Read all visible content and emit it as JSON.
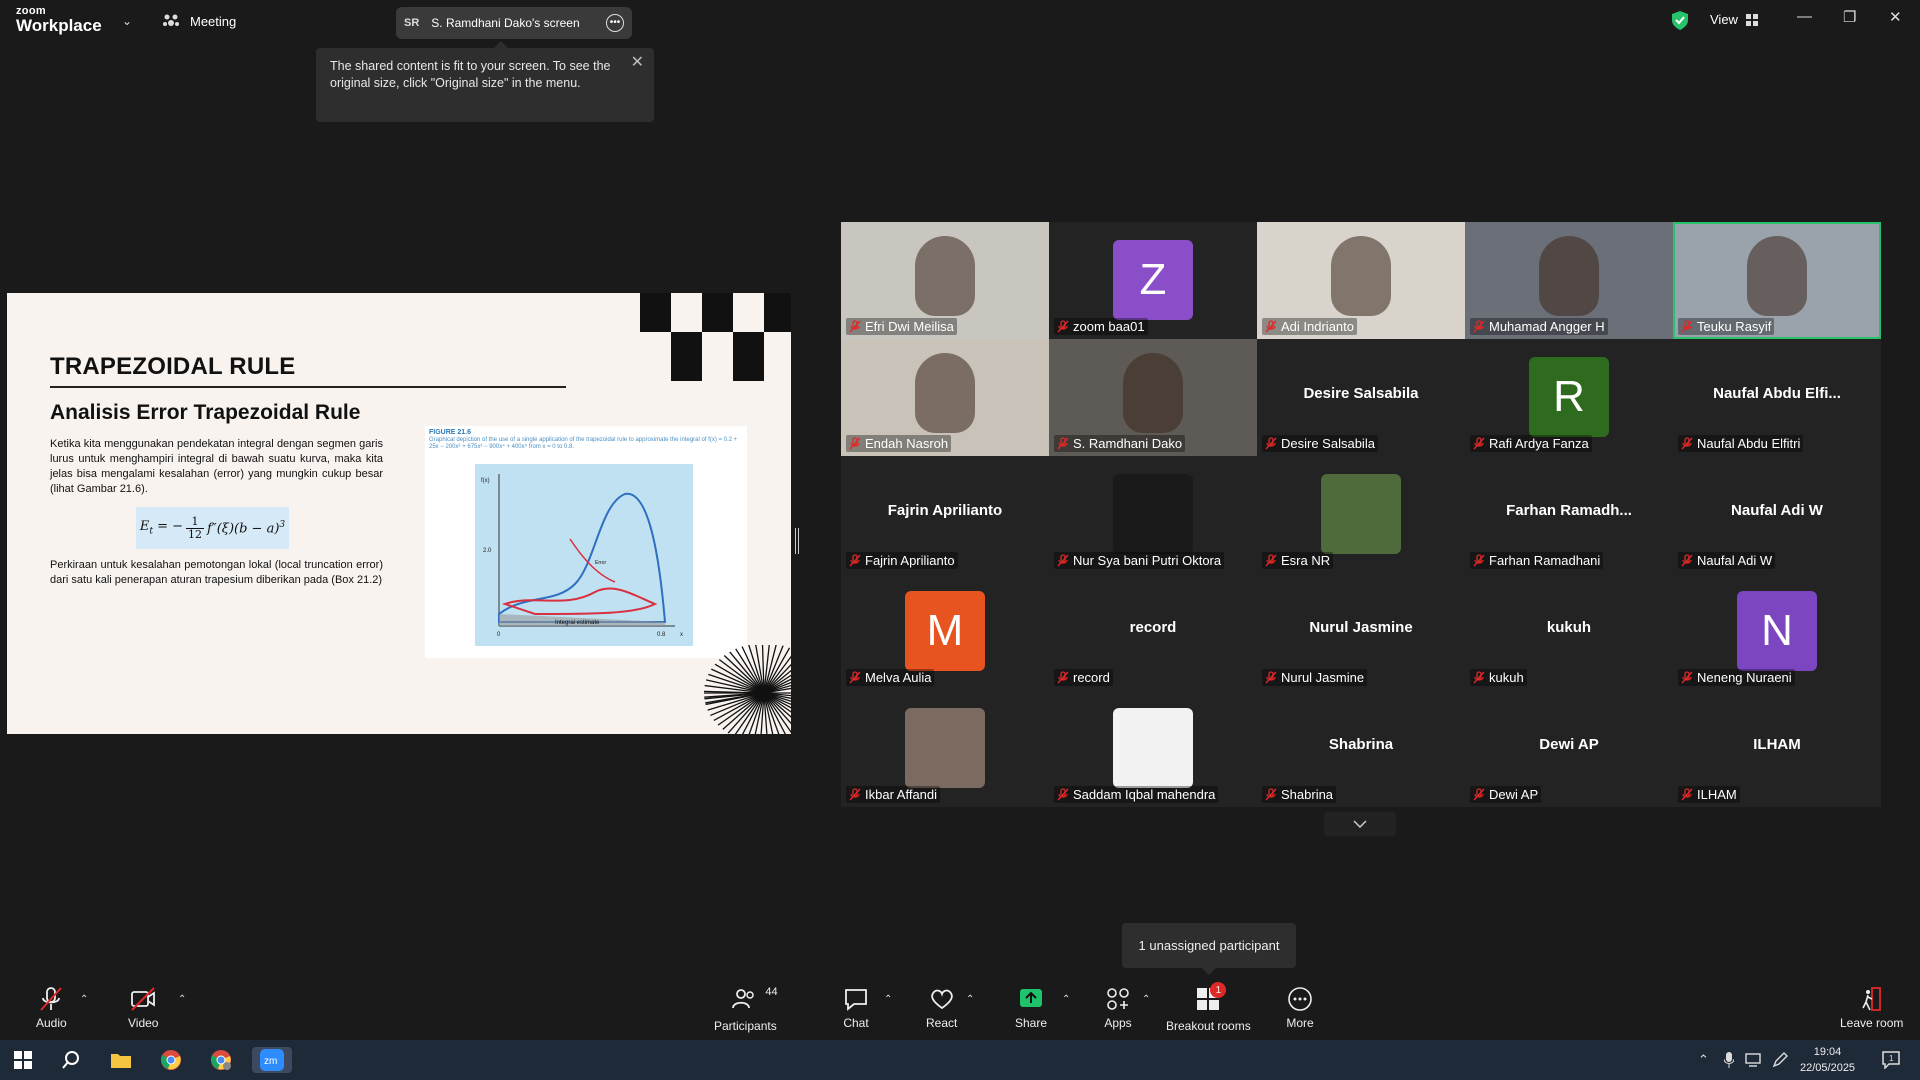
{
  "app": {
    "logo_line1": "zoom",
    "logo_line2": "Workplace",
    "meeting_label": "Meeting",
    "share_initials": "SR",
    "share_label": "S. Ramdhani Dako's screen",
    "view_label": "View"
  },
  "tooltip": {
    "text": "The shared content is fit to your screen. To see the original size, click \"Original size\" in the menu."
  },
  "slide": {
    "title": "TRAPEZOIDAL RULE",
    "subtitle": "Analisis Error Trapezoidal Rule",
    "para1": "Ketika kita menggunakan pendekatan integral dengan segmen garis lurus untuk menghampiri integral di bawah suatu kurva, maka kita jelas bisa mengalami kesalahan (error) yang mungkin cukup besar (lihat Gambar 21.6).",
    "para2": "Perkiraan untuk kesalahan pemotongan lokal (local truncation error) dari satu kali penerapan aturan trapesium diberikan pada (Box 21.2)",
    "figure_title": "FIGURE 21.6",
    "figure_caption": "Graphical depiction of the use of a single application of the trapezoidal rule to approximate the integral of f(x) = 0.2 + 25x − 200x² + 675x³ − 900x⁴ + 400x⁵ from x = 0 to 0.8.",
    "fig_ylabel": "f(x)",
    "fig_ytick": "2.0",
    "fig_x0": "0",
    "fig_x1": "0.8",
    "fig_xlabel": "x",
    "fig_estimate": "Integral estimate",
    "fig_error": "Error"
  },
  "participants_grid": [
    {
      "name": "Efri Dwi Meilisa",
      "type": "video",
      "bg": "#c9c6c0"
    },
    {
      "name": "zoom baa01",
      "type": "avatar",
      "letter": "Z",
      "color": "#8a4fc8"
    },
    {
      "name": "Adi Indrianto",
      "type": "video",
      "bg": "#d8d4cc"
    },
    {
      "name": "Muhamad Angger H",
      "type": "video",
      "bg": "#6b6f78"
    },
    {
      "name": "Teuku Rasyif",
      "type": "video",
      "bg": "#9aa3ab",
      "active": true
    },
    {
      "name": "Endah Nasroh",
      "type": "video",
      "bg": "#c8c2b9"
    },
    {
      "name": "S. Ramdhani Dako",
      "type": "video",
      "bg": "#5e5a56"
    },
    {
      "name": "Desire Salsabila",
      "type": "name",
      "display": "Desire Salsabila"
    },
    {
      "name": "Rafi Ardya Fanza",
      "type": "avatar",
      "letter": "R",
      "color": "#2e6b1f"
    },
    {
      "name": "Naufal Abdu Elfitri",
      "type": "name",
      "display": "Naufal  Abdu  Elfi..."
    },
    {
      "name": "Fajrin Aprilianto",
      "type": "name",
      "display": "Fajrin Aprilianto"
    },
    {
      "name": "Nur Sya bani Putri Oktora",
      "type": "photo",
      "bg": "#1a1a1a"
    },
    {
      "name": "Esra NR",
      "type": "photo",
      "bg": "#4f6b3c"
    },
    {
      "name": "Farhan Ramadhani",
      "type": "name",
      "display": "Farhan  Ramadh..."
    },
    {
      "name": "Naufal Adi W",
      "type": "name",
      "display": "Naufal Adi W"
    },
    {
      "name": "Melva Aulia",
      "type": "avatar",
      "letter": "M",
      "color": "#e8541f"
    },
    {
      "name": "record",
      "type": "name",
      "display": "record"
    },
    {
      "name": "Nurul Jasmine",
      "type": "name",
      "display": "Nurul Jasmine"
    },
    {
      "name": "kukuh",
      "type": "name",
      "display": "kukuh"
    },
    {
      "name": "Neneng Nuraeni",
      "type": "avatar",
      "letter": "N",
      "color": "#7c46c0"
    },
    {
      "name": "Ikbar Affandi",
      "type": "photo",
      "bg": "#7a6a60"
    },
    {
      "name": "Saddam Iqbal mahendra",
      "type": "photo",
      "bg": "#f2f2f2"
    },
    {
      "name": "Shabrina",
      "type": "name",
      "display": "Shabrina"
    },
    {
      "name": "Dewi AP",
      "type": "name",
      "display": "Dewi AP"
    },
    {
      "name": "ILHAM",
      "type": "name",
      "display": "ILHAM"
    }
  ],
  "unassigned_text": "1 unassigned participant",
  "toolbar": {
    "audio": "Audio",
    "video": "Video",
    "participants": "Participants",
    "participants_count": "44",
    "chat": "Chat",
    "react": "React",
    "share": "Share",
    "apps": "Apps",
    "breakout": "Breakout rooms",
    "breakout_badge": "1",
    "more": "More",
    "leave": "Leave room"
  },
  "taskbar": {
    "time": "19:04",
    "date": "22/05/2025",
    "notif_count": "1"
  },
  "colors": {
    "active_speaker": "#27c26c",
    "share_green": "#1fc36b",
    "mute_red": "#e02828"
  }
}
